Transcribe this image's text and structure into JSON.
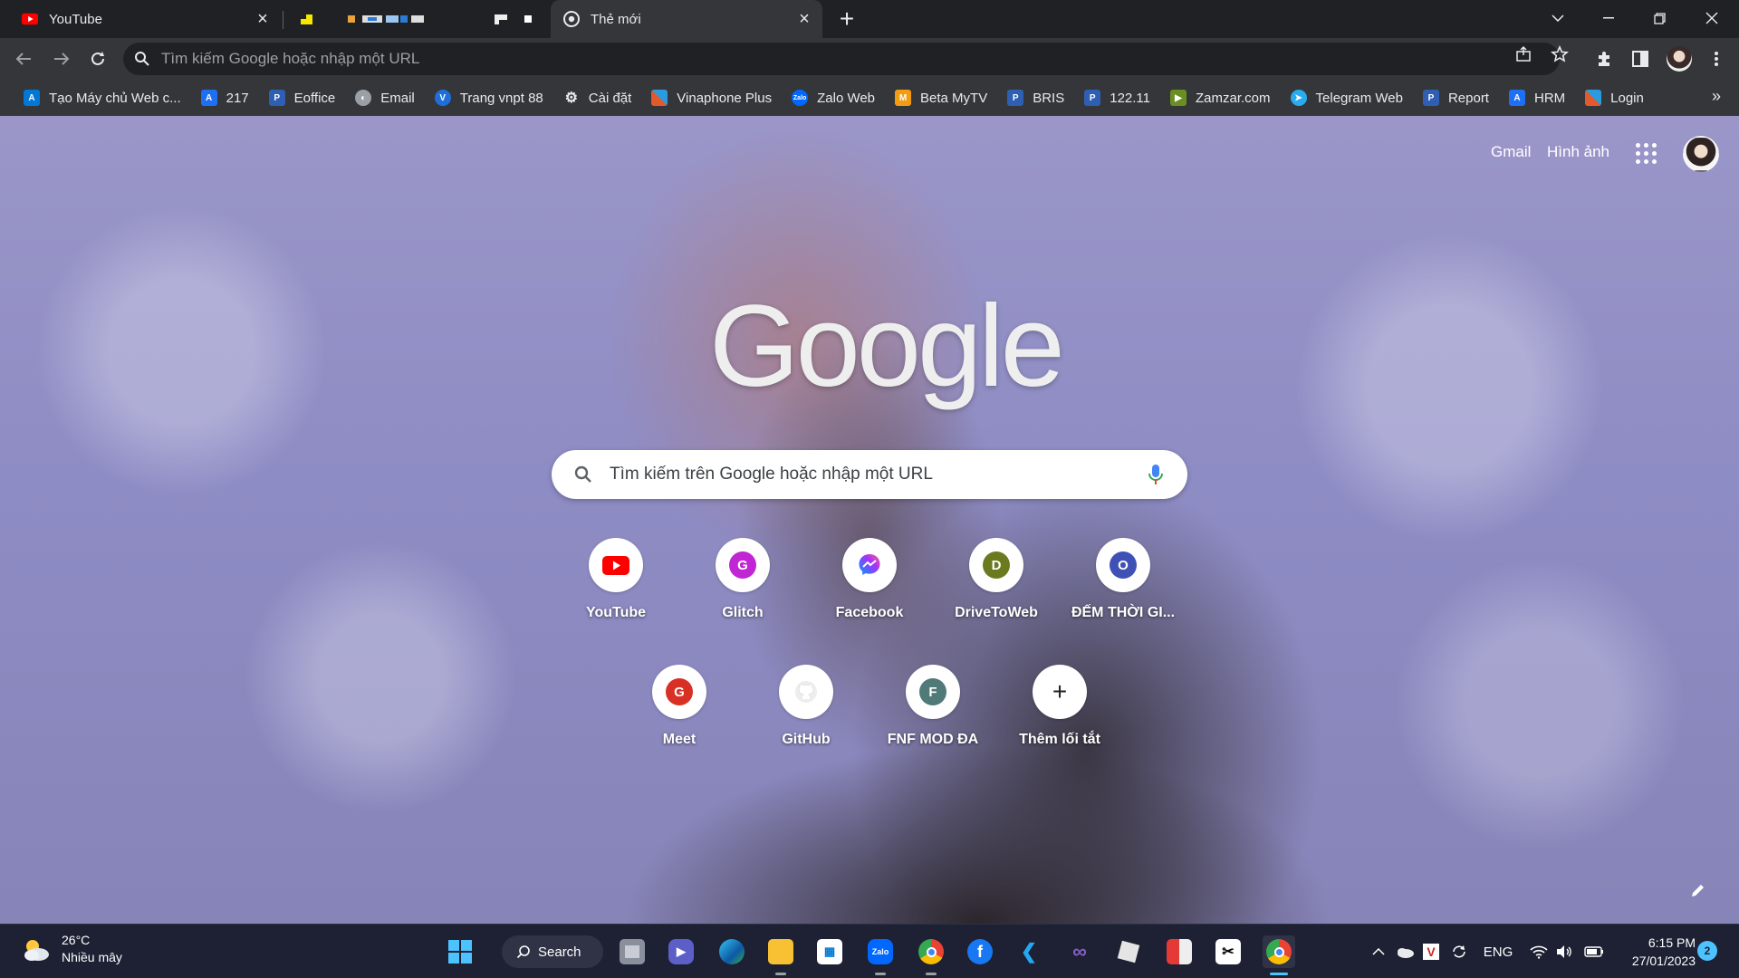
{
  "browser": {
    "tabs": [
      {
        "title": "YouTube",
        "favicon": "youtube-icon"
      },
      {
        "title": "",
        "favicon": "yellow-page-icon"
      },
      {
        "title": "",
        "favicon": "colored-strips-icon"
      },
      {
        "title": "",
        "favicon": "white-page-icon"
      },
      {
        "title": "Thẻ mới",
        "favicon": "chrome-icon",
        "active": true
      }
    ],
    "new_tab_symbol": "+",
    "omnibox": {
      "placeholder": "Tìm kiếm Google hoặc nhập một URL",
      "value": ""
    }
  },
  "bookmarks": [
    {
      "label": "Tạo Máy chủ Web c...",
      "icon": "azure-icon",
      "color": "#0078d4"
    },
    {
      "label": "217",
      "icon": "azure-icon",
      "color": "#1f6ff5"
    },
    {
      "label": "Eoffice",
      "icon": "doc-icon",
      "color": "#2f5fb3"
    },
    {
      "label": "Email",
      "icon": "globe-icon",
      "color": "#9aa0a6"
    },
    {
      "label": "Trang vnpt 88",
      "icon": "vnpt-icon",
      "color": "#1e6fd9"
    },
    {
      "label": "Cài đặt",
      "icon": "gear-icon",
      "color": "#9aa0a6"
    },
    {
      "label": "Vinaphone Plus",
      "icon": "grid-icon",
      "color": "#e05a2b"
    },
    {
      "label": "Zalo Web",
      "icon": "zalo-icon",
      "color": "#0068ff"
    },
    {
      "label": "Beta MyTV",
      "icon": "mytv-icon",
      "color": "#f39c12"
    },
    {
      "label": "BRIS",
      "icon": "doc-icon",
      "color": "#2f5fb3"
    },
    {
      "label": "122.11",
      "icon": "doc-icon",
      "color": "#2f5fb3"
    },
    {
      "label": "Zamzar.com",
      "icon": "zamzar-icon",
      "color": "#6b8e23"
    },
    {
      "label": "Telegram Web",
      "icon": "telegram-icon",
      "color": "#2aabee"
    },
    {
      "label": "Report",
      "icon": "doc-icon",
      "color": "#2f5fb3"
    },
    {
      "label": "HRM",
      "icon": "azure-icon",
      "color": "#1f6ff5"
    },
    {
      "label": "Login",
      "icon": "grid-icon",
      "color": "#e05a2b"
    }
  ],
  "bookmarks_more": "»",
  "ntp": {
    "links": {
      "gmail": "Gmail",
      "images": "Hình ảnh"
    },
    "logo_text": "Google",
    "search_placeholder": "Tìm kiếm trên Google hoặc nhập một URL",
    "shortcuts": [
      {
        "label": "YouTube",
        "icon": "youtube-icon",
        "letter": ""
      },
      {
        "label": "Glitch",
        "icon": "letter-icon",
        "letter": "G",
        "color": "#c026d3"
      },
      {
        "label": "Facebook",
        "icon": "messenger-icon",
        "letter": ""
      },
      {
        "label": "DriveToWeb",
        "icon": "letter-icon",
        "letter": "D",
        "color": "#6b7a1e"
      },
      {
        "label": "ĐẾM THỜI GI...",
        "icon": "letter-icon",
        "letter": "O",
        "color": "#3f51b5"
      },
      {
        "label": "Meet",
        "icon": "letter-icon",
        "letter": "G",
        "color": "#d93025"
      },
      {
        "label": "GitHub",
        "icon": "github-icon",
        "letter": ""
      },
      {
        "label": "FNF MOD ĐA",
        "icon": "letter-icon",
        "letter": "F",
        "color": "#4f7a78"
      },
      {
        "label": "Thêm lối tắt",
        "icon": "plus-icon",
        "letter": "+"
      }
    ]
  },
  "taskbar": {
    "weather": {
      "temp": "26°C",
      "desc": "Nhiều mây"
    },
    "search_label": "Search",
    "language": "ENG",
    "time": "6:15 PM",
    "date": "27/01/2023",
    "notifications": "2"
  }
}
